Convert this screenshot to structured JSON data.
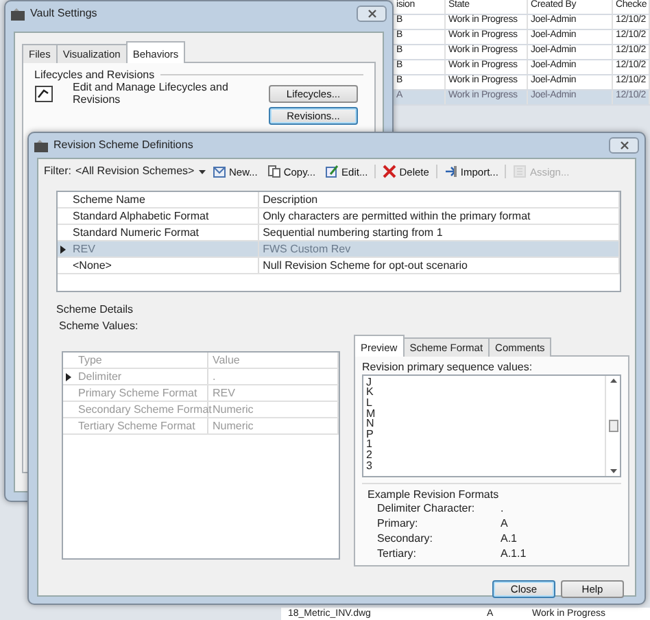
{
  "background_table": {
    "columns": [
      "ision",
      "State",
      "Created By",
      "Checke"
    ],
    "rows": [
      {
        "cells": [
          "B",
          "Work in Progress",
          "Joel-Admin",
          "12/10/2"
        ],
        "selected": false
      },
      {
        "cells": [
          "B",
          "Work in Progress",
          "Joel-Admin",
          "12/10/2"
        ],
        "selected": false
      },
      {
        "cells": [
          "B",
          "Work in Progress",
          "Joel-Admin",
          "12/10/2"
        ],
        "selected": false
      },
      {
        "cells": [
          "B",
          "Work in Progress",
          "Joel-Admin",
          "12/10/2"
        ],
        "selected": false
      },
      {
        "cells": [
          "B",
          "Work in Progress",
          "Joel-Admin",
          "12/10/2"
        ],
        "selected": false
      },
      {
        "cells": [
          "A",
          "Work in Progress",
          "Joel-Admin",
          "12/10/2"
        ],
        "selected": true
      }
    ],
    "bottom_row": [
      "18_Metric_INV.dwg",
      "A",
      "Work in Progress"
    ]
  },
  "vault_settings": {
    "title": "Vault Settings",
    "tabs": [
      {
        "label": "Files",
        "selected": false
      },
      {
        "label": "Visualization",
        "selected": false
      },
      {
        "label": "Behaviors",
        "selected": true
      }
    ],
    "group": "Lifecycles and Revisions",
    "description": "Edit and Manage Lifecycles and Revisions",
    "buttons": [
      {
        "label": "Lifecycles...",
        "focused": false
      },
      {
        "label": "Revisions...",
        "focused": true
      }
    ]
  },
  "revision_dialog": {
    "title": "Revision Scheme Definitions",
    "filter": {
      "label": "Filter:",
      "value": "<All Revision Schemes>"
    },
    "toolbar": [
      {
        "label": "New...",
        "kind": "new",
        "disabled": false
      },
      {
        "label": "Copy...",
        "kind": "copy",
        "disabled": false
      },
      {
        "label": "Edit...",
        "kind": "edit",
        "disabled": false
      },
      {
        "label": "Delete",
        "kind": "delete",
        "disabled": false
      },
      {
        "label": "Import...",
        "kind": "import",
        "disabled": false
      },
      {
        "label": "Assign...",
        "kind": "assign",
        "disabled": true
      }
    ],
    "schemes": {
      "columns": [
        "Scheme Name",
        "Description"
      ],
      "rows": [
        {
          "cells": [
            "Standard Alphabetic Format",
            "Only characters are permitted within the primary format"
          ],
          "selected": false
        },
        {
          "cells": [
            "Standard Numeric Format",
            "Sequential numbering starting from 1"
          ],
          "selected": false
        },
        {
          "cells": [
            "REV",
            "FWS Custom Rev"
          ],
          "selected": true
        },
        {
          "cells": [
            "<None>",
            "Null Revision Scheme for opt-out scenario"
          ],
          "selected": false
        }
      ]
    },
    "details_title": "Scheme Details",
    "values_title": "Scheme Values:",
    "scheme_values": {
      "disabled": true,
      "columns": [
        "Type",
        "Value"
      ],
      "rows": [
        {
          "cells": [
            "Delimiter",
            "."
          ],
          "current": true
        },
        {
          "cells": [
            "Primary Scheme Format",
            "REV"
          ],
          "current": false
        },
        {
          "cells": [
            "Secondary Scheme Format",
            "Numeric"
          ],
          "current": false
        },
        {
          "cells": [
            "Tertiary Scheme Format",
            "Numeric"
          ],
          "current": false
        }
      ]
    },
    "tabs": [
      {
        "label": "Preview",
        "selected": true
      },
      {
        "label": "Scheme Format",
        "selected": false
      },
      {
        "label": "Comments",
        "selected": false
      }
    ],
    "sequence_label": "Revision primary sequence values:",
    "sequence_values": [
      "J",
      "K",
      "L",
      "M",
      "N",
      "P",
      "1",
      "2",
      "3"
    ],
    "examples_title": "Example Revision Formats",
    "examples": [
      {
        "label": "Delimiter Character:",
        "value": "."
      },
      {
        "label": "Primary:",
        "value": "A"
      },
      {
        "label": "Secondary:",
        "value": "A.1"
      },
      {
        "label": "Tertiary:",
        "value": "A.1.1"
      }
    ],
    "buttons": [
      {
        "label": "Close",
        "focused": true
      },
      {
        "label": "Help",
        "focused": false
      }
    ]
  }
}
